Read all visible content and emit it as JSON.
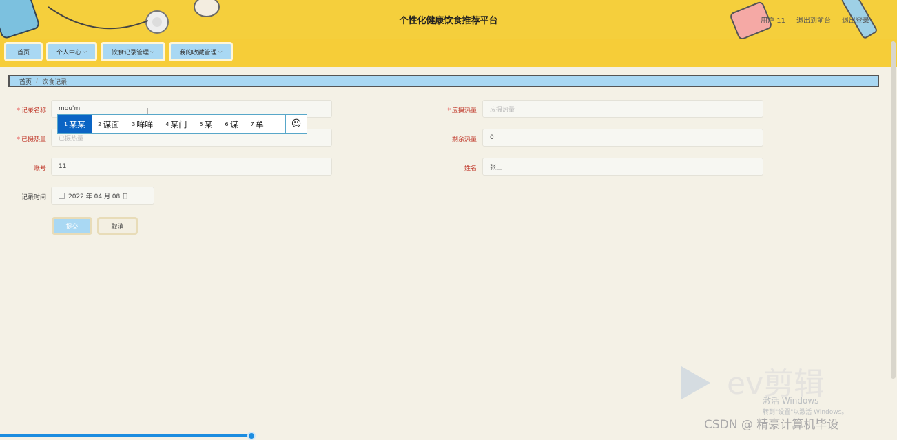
{
  "header": {
    "title": "个性化健康饮食推荐平台",
    "user": "用户 11",
    "back_front": "退出到前台",
    "logout": "退出登录"
  },
  "nav": {
    "home": "首页",
    "personal": "个人中心",
    "diet_records": "饮食记录管理",
    "favorites": "我的收藏管理"
  },
  "breadcrumb": {
    "home": "首页",
    "separator": "/",
    "current": "饮食记录"
  },
  "form": {
    "record_name": {
      "label": "记录名称",
      "value": "mou'm",
      "required": true
    },
    "should_intake": {
      "label": "应摄热量",
      "placeholder": "应摄热量",
      "required": true
    },
    "taken_intake": {
      "label": "已摄热量",
      "placeholder": "已摄热量",
      "required": true
    },
    "remaining": {
      "label": "剩余热量",
      "value": "0"
    },
    "account": {
      "label": "账号",
      "value": "11"
    },
    "name": {
      "label": "姓名",
      "value": "张三"
    },
    "record_time": {
      "label": "记录时间",
      "value": "2022 年 04 月 08 日"
    },
    "submit": "提交",
    "cancel": "取消"
  },
  "ime": {
    "candidates": [
      {
        "num": "1",
        "text": "某某"
      },
      {
        "num": "2",
        "text": "谋面"
      },
      {
        "num": "3",
        "text": "哞哞"
      },
      {
        "num": "4",
        "text": "某门"
      },
      {
        "num": "5",
        "text": "某"
      },
      {
        "num": "6",
        "text": "谋"
      },
      {
        "num": "7",
        "text": "牟"
      }
    ],
    "emoji": "☺"
  },
  "watermark": {
    "activate_title": "激活 Windows",
    "activate_sub": "转到\"设置\"以激活 Windows。",
    "csdn": "CSDN @ 精豪计算机毕设"
  },
  "video_progress": 0.28,
  "colors": {
    "header": "#f5cf3c",
    "nav_btn": "#a9d8f3",
    "accent": "#1c8de0",
    "bg": "#f4f1e6"
  }
}
